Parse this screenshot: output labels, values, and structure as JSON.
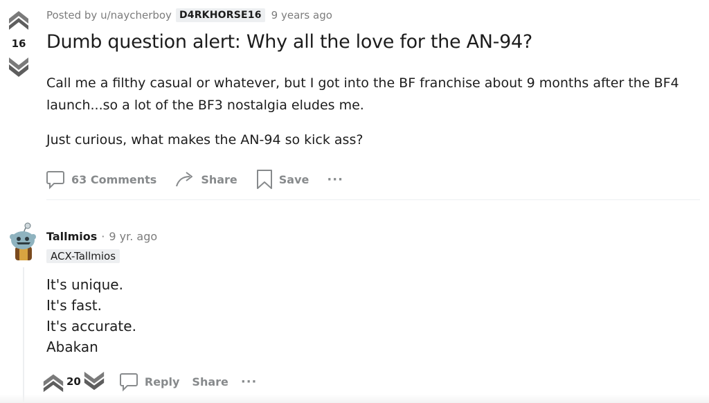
{
  "post": {
    "meta": {
      "posted_by": "Posted by u/naycherboy",
      "flair": "D4RKHORSE16",
      "time": "9 years ago"
    },
    "score": "16",
    "title": "Dumb question alert: Why all the love for the AN-94?",
    "body": [
      "Call me a filthy casual or whatever, but I got into the BF franchise about 9 months after the BF4 launch...so a lot of the BF3 nostalgia eludes me.",
      "Just curious, what makes the AN-94 so kick ass?"
    ],
    "actions": {
      "comments": "63 Comments",
      "share": "Share",
      "save": "Save",
      "more": "···"
    }
  },
  "comment": {
    "author": "Tallmios",
    "separator": "·",
    "time": "9 yr. ago",
    "flair": "ACX-Tallmios",
    "lines": [
      "It's unique.",
      "It's fast.",
      "It's accurate.",
      "Abakan"
    ],
    "score": "20",
    "actions": {
      "reply": "Reply",
      "share": "Share",
      "more": "···"
    }
  },
  "icons": {
    "upvote": "upvote-chevron-icon",
    "downvote": "downvote-chevron-icon",
    "comment": "speech-bubble-icon",
    "share": "share-arrow-icon",
    "save": "bookmark-icon",
    "more": "ellipsis-icon",
    "avatar": "snoo-avatar-icon"
  },
  "colors": {
    "text": "#1c1c1c",
    "muted": "#7c7c7c",
    "action": "#878a8c",
    "flair_bg": "#edeff1",
    "vote_icon": "#6b6b6b"
  }
}
